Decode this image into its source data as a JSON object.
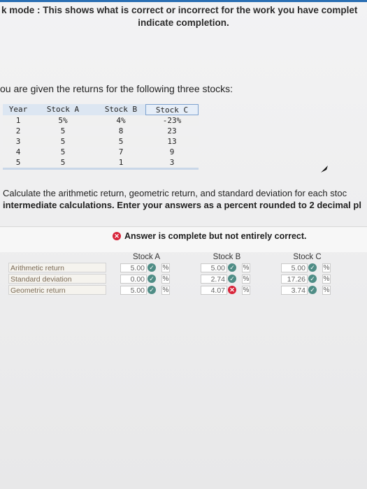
{
  "banner": {
    "line1": "k mode : This shows what is correct or incorrect for the work you have complet",
    "line2": "indicate completion."
  },
  "intro": "ou are given the returns for the following three stocks:",
  "returns_table": {
    "headers": [
      "Year",
      "Stock A",
      "Stock B",
      "Stock C"
    ],
    "rows": [
      [
        "1",
        "5%",
        "4%",
        "-23%"
      ],
      [
        "2",
        "5",
        "8",
        "23"
      ],
      [
        "3",
        "5",
        "5",
        "13"
      ],
      [
        "4",
        "5",
        "7",
        "9"
      ],
      [
        "5",
        "5",
        "1",
        "3"
      ]
    ]
  },
  "question": {
    "line1": "Calculate the arithmetic return, geometric return, and standard deviation for each stoc",
    "line2": "intermediate calculations. Enter your answers as a percent rounded to 2 decimal pl"
  },
  "answer_status": "Answer is complete but not entirely correct.",
  "answer_table": {
    "headers": [
      "Stock A",
      "Stock B",
      "Stock C"
    ],
    "rows": [
      {
        "label": "Arithmetic return",
        "cells": [
          {
            "value": "5.00",
            "status": "correct",
            "unit": "%"
          },
          {
            "value": "5.00",
            "status": "correct",
            "unit": "%"
          },
          {
            "value": "5.00",
            "status": "correct",
            "unit": "%"
          }
        ]
      },
      {
        "label": "Standard deviation",
        "cells": [
          {
            "value": "0.00",
            "status": "correct",
            "unit": "%"
          },
          {
            "value": "2.74",
            "status": "correct",
            "unit": "%"
          },
          {
            "value": "17.26",
            "status": "correct",
            "unit": "%"
          }
        ]
      },
      {
        "label": "Geometric return",
        "cells": [
          {
            "value": "5.00",
            "status": "correct",
            "unit": "%"
          },
          {
            "value": "4.07",
            "status": "incorrect",
            "unit": "%"
          },
          {
            "value": "3.74",
            "status": "correct",
            "unit": "%"
          }
        ]
      }
    ]
  },
  "colors": {
    "correct": "#4f8d86",
    "incorrect": "#d8243a",
    "header_fill": "#dce6f2"
  },
  "icons": {
    "correct": "check-circle-icon",
    "incorrect": "x-circle-icon",
    "cursor": "mouse-pointer-icon"
  }
}
